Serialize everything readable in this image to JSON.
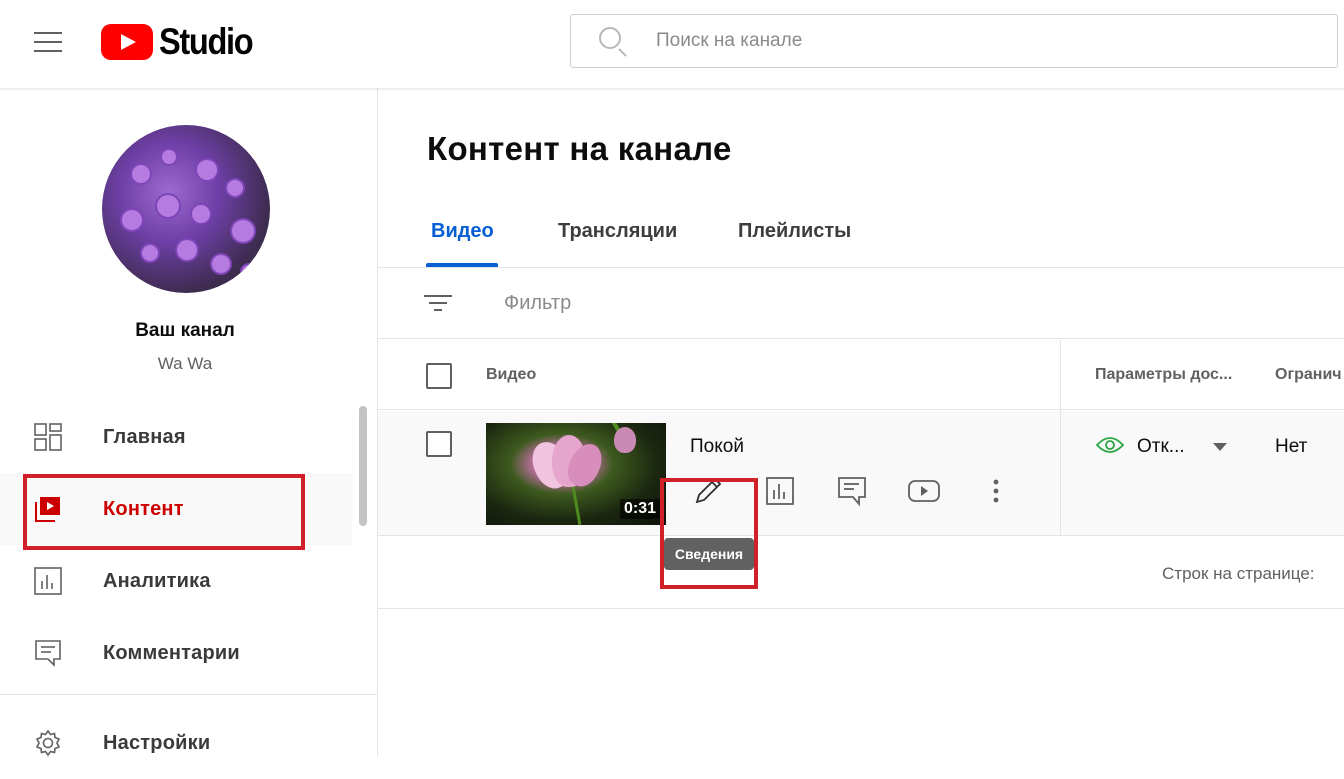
{
  "app": {
    "logo_text": "Studio",
    "brand_color": "#ff0000"
  },
  "search": {
    "placeholder": "Поиск на канале"
  },
  "channel": {
    "title": "Ваш канал",
    "subtitle": "Wa Wa"
  },
  "sidebar": {
    "items": [
      {
        "label": "Главная",
        "icon": "dashboard-icon",
        "active": false
      },
      {
        "label": "Контент",
        "icon": "content-icon",
        "active": true
      },
      {
        "label": "Аналитика",
        "icon": "analytics-icon",
        "active": false
      },
      {
        "label": "Комментарии",
        "icon": "comments-icon",
        "active": false
      },
      {
        "label": "Настройки",
        "icon": "settings-icon",
        "active": false
      }
    ]
  },
  "main": {
    "title": "Контент на канале",
    "tabs": [
      {
        "label": "Видео",
        "active": true
      },
      {
        "label": "Трансляции",
        "active": false
      },
      {
        "label": "Плейлисты",
        "active": false
      }
    ],
    "filter_label": "Фильтр",
    "columns": {
      "video": "Видео",
      "visibility": "Параметры дос...",
      "restrictions": "Огранич"
    },
    "rows": [
      {
        "title": "Покой",
        "duration": "0:31",
        "visibility": "Отк...",
        "restrictions": "Нет"
      }
    ],
    "row_actions": [
      "edit-icon",
      "analytics-icon",
      "comments-icon",
      "youtube-icon",
      "more-icon"
    ],
    "tooltip": "Сведения",
    "pager_label": "Строк на странице:"
  },
  "colors": {
    "accent": "#065fd4",
    "active_nav": "#cc0000",
    "highlight": "#d0202a",
    "visibility_green": "#2ba640"
  }
}
